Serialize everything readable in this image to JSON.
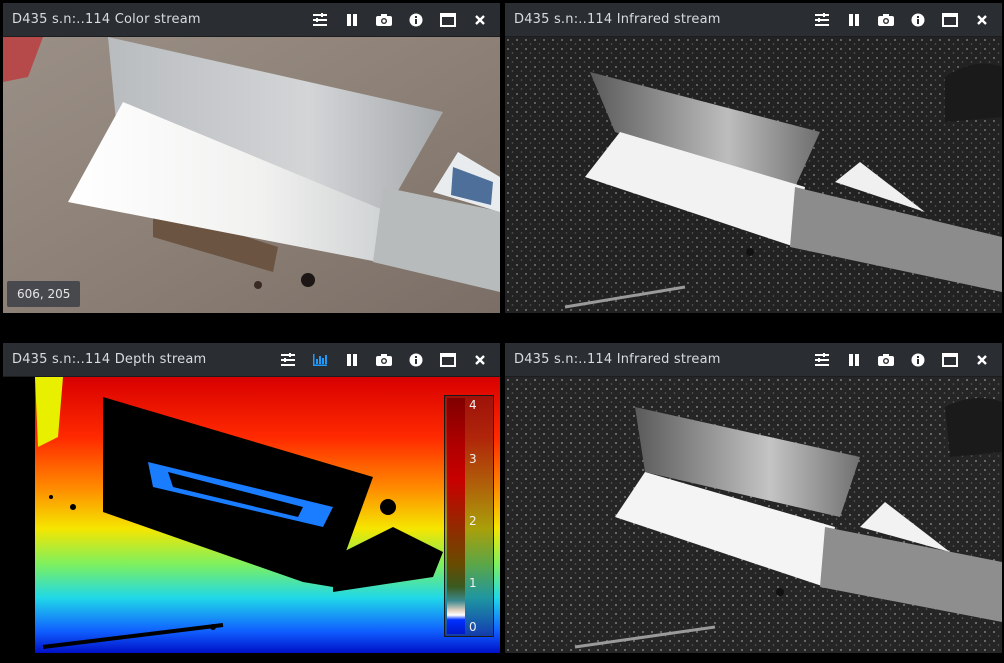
{
  "panels": {
    "color": {
      "title": "D435 s.n:..114 Color stream",
      "coords": "606, 205"
    },
    "ir1": {
      "title": "D435 s.n:..114 Infrared stream"
    },
    "depth": {
      "title": "D435 s.n:..114 Depth stream",
      "colorbar_labels": [
        "4",
        "3",
        "2",
        "1",
        "0"
      ]
    },
    "ir2": {
      "title": "D435 s.n:..114 Infrared stream"
    }
  },
  "icons": [
    "options-icon",
    "histogram-icon",
    "pause-icon",
    "camera-icon",
    "info-icon",
    "maximize-icon",
    "close-icon"
  ],
  "colors": {
    "titlebar": "#2a2d31",
    "icon": "#ffffff",
    "accent": "#1e9bff",
    "text": "#d8dcdf"
  }
}
